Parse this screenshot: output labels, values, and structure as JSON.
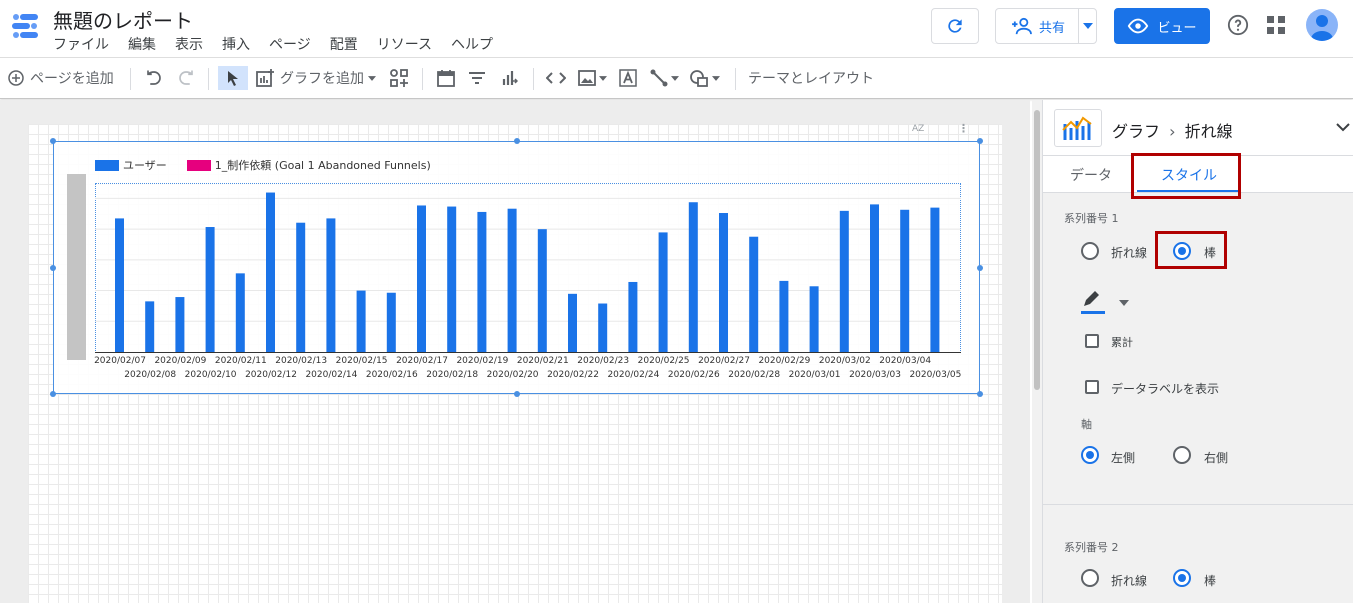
{
  "app": {
    "title": "無題のレポート",
    "menu": [
      "ファイル",
      "編集",
      "表示",
      "挿入",
      "ページ",
      "配置",
      "リソース",
      "ヘルプ"
    ],
    "share_label": "共有",
    "view_label": "ビュー"
  },
  "toolbar": {
    "add_page": "ページを追加",
    "add_chart": "グラフを追加",
    "theme_layout": "テーマとレイアウト"
  },
  "chart": {
    "legend": [
      {
        "label": "ユーザー",
        "color": "#1a73e8"
      },
      {
        "label": "1_制作依頼 (Goal 1 Abandoned Funnels)",
        "color": "#e6007e"
      }
    ],
    "sort_icon_label": "AZ"
  },
  "chart_data": {
    "type": "bar",
    "categories": [
      "2020/02/07",
      "2020/02/08",
      "2020/02/09",
      "2020/02/10",
      "2020/02/11",
      "2020/02/12",
      "2020/02/13",
      "2020/02/14",
      "2020/02/15",
      "2020/02/16",
      "2020/02/17",
      "2020/02/18",
      "2020/02/19",
      "2020/02/20",
      "2020/02/21",
      "2020/02/22",
      "2020/02/23",
      "2020/02/24",
      "2020/02/25",
      "2020/02/26",
      "2020/02/27",
      "2020/02/28",
      "2020/02/29",
      "2020/03/01",
      "2020/03/02",
      "2020/03/03",
      "2020/03/04",
      "2020/03/05"
    ],
    "series": [
      {
        "name": "ユーザー",
        "values": [
          124,
          47,
          51,
          116,
          73,
          148,
          120,
          124,
          57,
          55,
          136,
          135,
          130,
          133,
          114,
          54,
          45,
          65,
          111,
          139,
          129,
          107,
          66,
          61,
          131,
          137,
          132,
          134
        ]
      }
    ],
    "ylim": [
      0,
      155
    ]
  },
  "panel": {
    "breadcrumb_root": "グラフ",
    "breadcrumb_leaf": "折れ線",
    "tabs": [
      "データ",
      "スタイル"
    ],
    "series1_title": "系列番号 1",
    "series2_title": "系列番号 2",
    "opt_line": "折れ線",
    "opt_bar": "棒",
    "cumulative": "累計",
    "show_labels": "データラベルを表示",
    "axis_title": "軸",
    "axis_left": "左側",
    "axis_right": "右側"
  }
}
